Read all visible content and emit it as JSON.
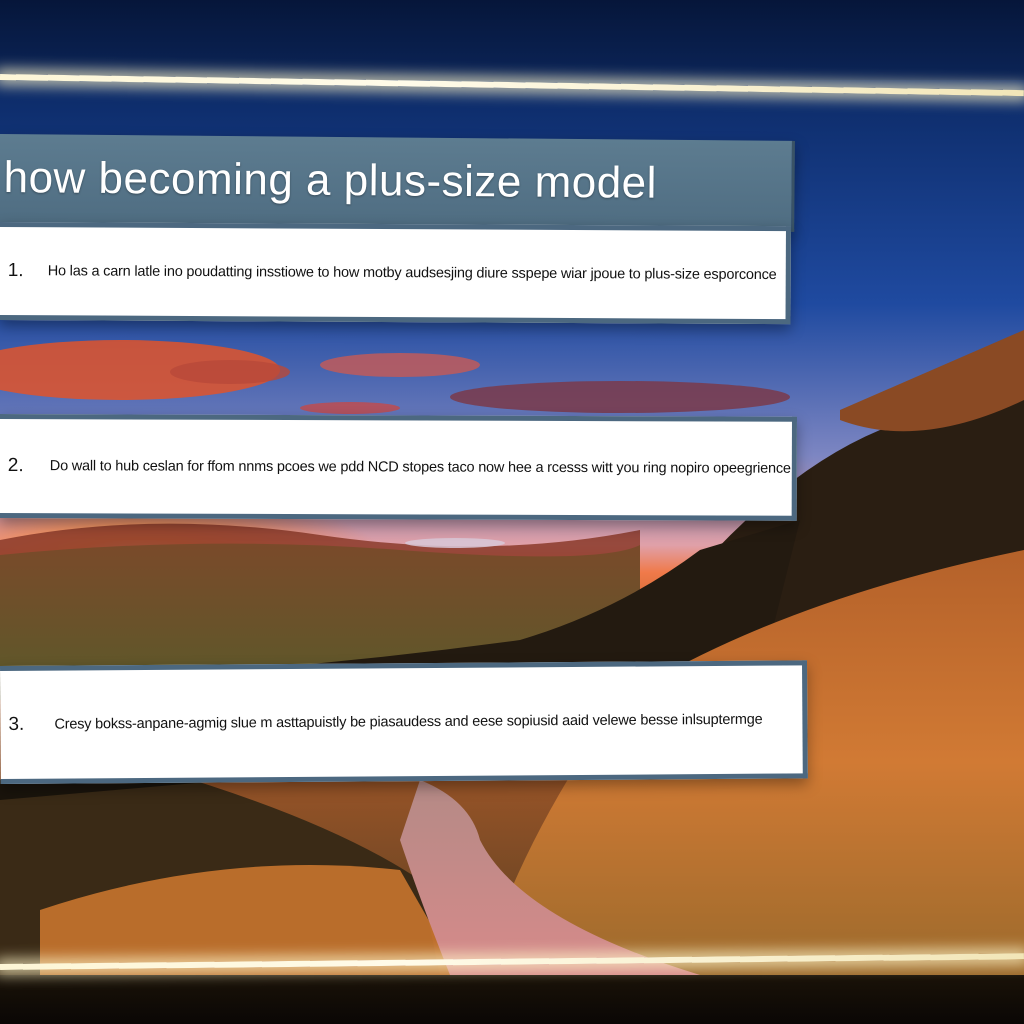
{
  "title": "how becoming a plus-size model",
  "steps": [
    {
      "number": "1.",
      "text": "Ho las a carn latle ino poudatting insstiowe to how motby audsesjing diure sspepe wiar jpoue to plus-size esporconce"
    },
    {
      "number": "2.",
      "text": "Do wall to hub ceslan for ffom nnms pcoes we pdd NCD stopes taco now hee a rcesss witt you ring nopiro opeegrience"
    },
    {
      "number": "3.",
      "text": "Cresy bokss-anpane-agmig slue m asttapuistly be piasaudess and eese sopiusid aaid velewe besse inlsuptermge"
    }
  ],
  "colors": {
    "banner": "#5d7c90",
    "card_border": "#4c6880",
    "card_bg": "#ffffff",
    "sky_top": "#0b2457",
    "sunset": "#e8582a"
  }
}
